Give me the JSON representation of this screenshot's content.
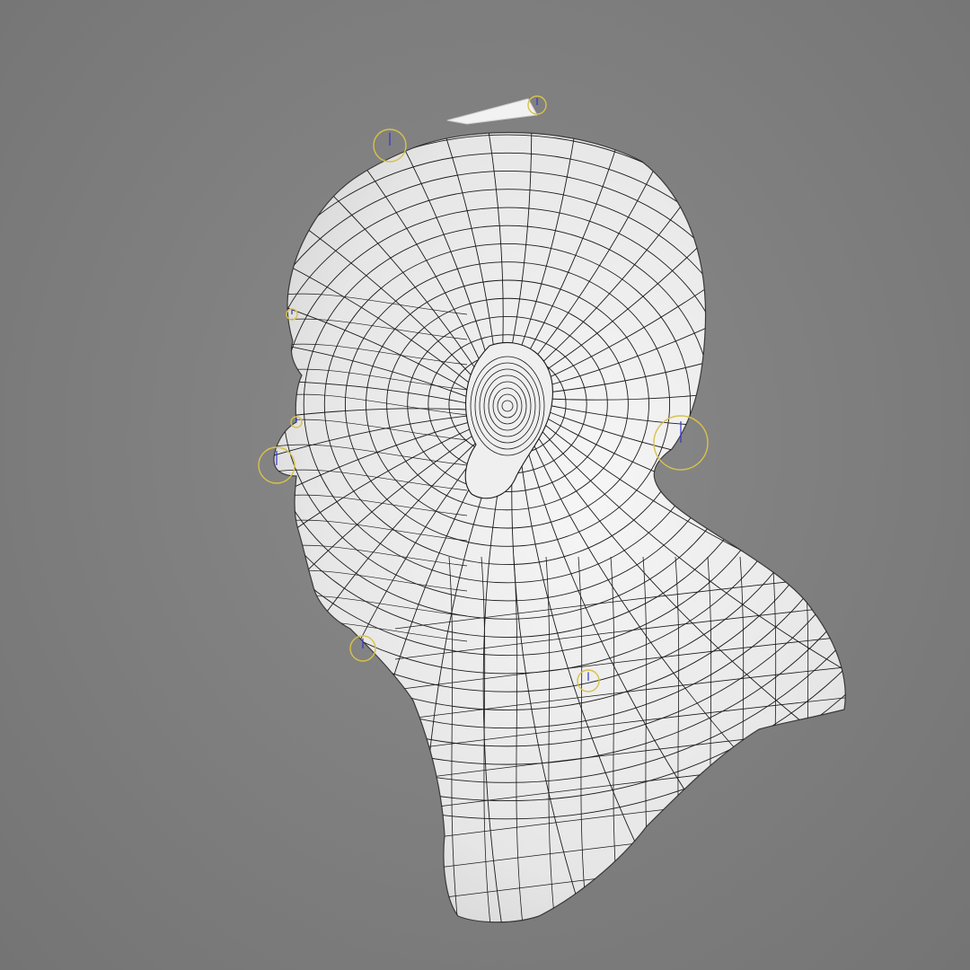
{
  "viewport": {
    "background_color": "#808080",
    "mesh_fill_color": "#ececec",
    "wire_color": "#1a1a1a",
    "rig_handle_color": "#d8c24a",
    "rig_axis_colors": [
      "#3333cc",
      "#cc3333",
      "#33aa33"
    ]
  },
  "model": {
    "icon": "head-mesh-icon",
    "view": "left-side-three-quarter",
    "display": "wireframe-on-shaded",
    "has_rig_controls": true
  }
}
